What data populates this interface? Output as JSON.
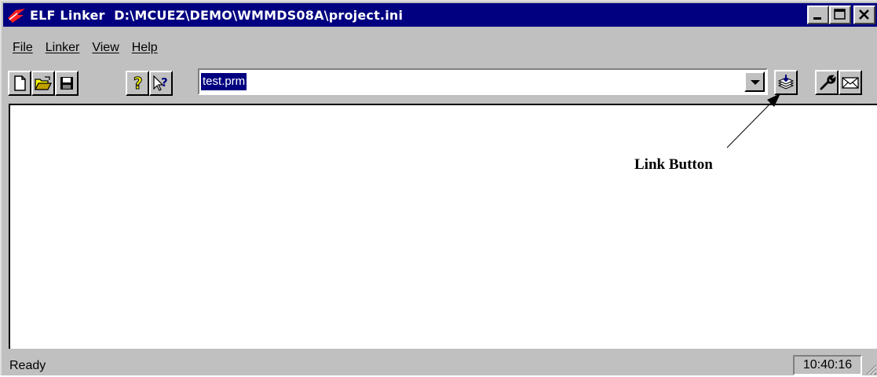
{
  "window": {
    "app_name": "ELF Linker",
    "file_path": "D:\\MCUEZ\\DEMO\\WMMDS08A\\project.ini"
  },
  "menu": {
    "items": [
      {
        "label": "File"
      },
      {
        "label": "Linker"
      },
      {
        "label": "View"
      },
      {
        "label": "Help"
      }
    ]
  },
  "toolbar": {
    "buttons": [
      {
        "icon": "new-file-icon"
      },
      {
        "icon": "open-folder-icon"
      },
      {
        "icon": "save-disk-icon"
      },
      {
        "icon": "help-question-icon"
      },
      {
        "icon": "context-help-icon"
      },
      {
        "icon": "link-icon"
      },
      {
        "icon": "options-wrench-icon"
      },
      {
        "icon": "message-envelope-icon"
      }
    ],
    "combo_value": "test.prm"
  },
  "status": {
    "text": "Ready",
    "time": "10:40:16"
  },
  "annotation": {
    "label": "Link Button"
  },
  "colors": {
    "title_bg": "#000080",
    "face": "#c0c0c0",
    "selection": "#000080"
  }
}
